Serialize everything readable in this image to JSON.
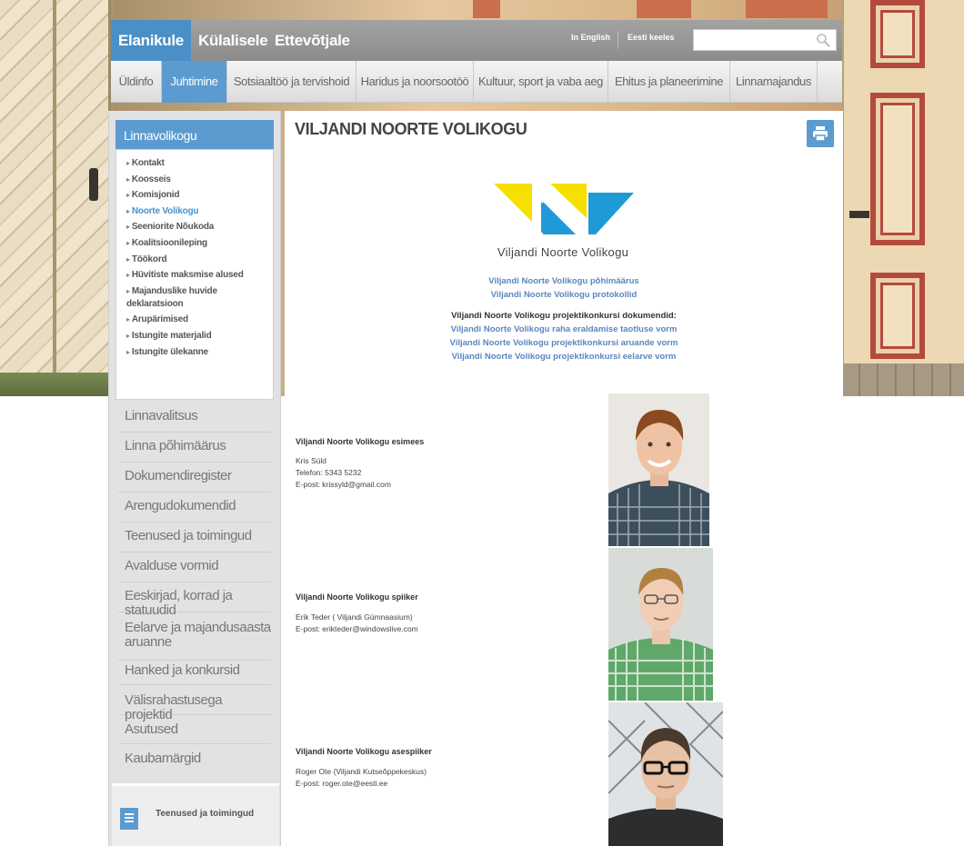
{
  "topnav": {
    "tabs": [
      {
        "label": "Elanikule",
        "active": true
      },
      {
        "label": "Külalisele",
        "active": false
      },
      {
        "label": "Ettevõtjale",
        "active": false
      }
    ],
    "lang_english": "In English",
    "lang_estonian": "Eesti keeles",
    "search_placeholder": ""
  },
  "subnav": {
    "items": [
      {
        "label": "Üldinfo",
        "active": false
      },
      {
        "label": "Juhtimine",
        "active": true
      },
      {
        "label": "Sotsiaaltöö ja tervishoid",
        "active": false
      },
      {
        "label": "Haridus ja noorsootöö",
        "active": false
      },
      {
        "label": "Kultuur, sport ja vaba aeg",
        "active": false
      },
      {
        "label": "Ehitus ja planeerimine",
        "active": false
      },
      {
        "label": "Linnamajandus",
        "active": false
      }
    ]
  },
  "sidebar": {
    "active_section": "Linnavolikogu",
    "sub_items": [
      {
        "label": "Kontakt"
      },
      {
        "label": "Koosseis"
      },
      {
        "label": "Komisjonid"
      },
      {
        "label": "Noorte Volikogu",
        "current": true
      },
      {
        "label": "Seeniorite Nõukoda"
      },
      {
        "label": "Koalitsioonileping"
      },
      {
        "label": "Töökord"
      },
      {
        "label": "Hüvitiste maksmise alused"
      },
      {
        "label": "Majanduslike huvide deklaratsioon"
      },
      {
        "label": "Arupärimised"
      },
      {
        "label": "Istungite materjalid"
      },
      {
        "label": "Istungite ülekanne"
      }
    ],
    "sections": [
      "Linnavalitsus",
      "Linna põhimäärus",
      "Dokumendiregister",
      "Arengudokumendid",
      "Teenused ja toimingud",
      "Avalduse vormid",
      "Eeskirjad, korrad ja statuudid",
      "Eelarve ja majandusaasta aruanne",
      "Hanked ja konkursid",
      "Välisrahastusega projektid",
      "Asutused",
      "Kaubamärgid"
    ],
    "box_label": "Teenused ja toimingud"
  },
  "content": {
    "title": "VILJANDI NOORTE VOLIKOGU",
    "logo_text": "Viljandi Noorte Volikogu",
    "links_top": [
      "Viljandi Noorte Volikogu põhimäärus",
      "Viljandi Noorte Volikogu protokollid"
    ],
    "docs_heading": "Viljandi Noorte Volikogu projektikonkursi dokumendid:",
    "docs_links": [
      "Viljandi Noorte Volikogu raha eraldamise taotluse vorm",
      "Viljandi Noorte Volikogu projektikonkursi aruande vorm",
      "Viljandi Noorte Volikogu projektikonkursi eelarve vorm"
    ],
    "people": [
      {
        "role": "Viljandi Noorte Volikogu esimees",
        "lines": [
          "Kris Süld",
          "Telefon: 5343 5232",
          "E-post: krissyld@gmail.com"
        ]
      },
      {
        "role": "Viljandi Noorte Volikogu spiiker",
        "lines": [
          "Erik Teder ( Viljandi Gümnaasium)",
          "E-post: erikteder@windowslive.com"
        ]
      },
      {
        "role": "Viljandi Noorte Volikogu asespiiker",
        "lines": [
          "Roger Ote (Viljandi Kutseõppekeskus)",
          "E-post: roger.ote@eesti.ee"
        ]
      }
    ]
  },
  "colors": {
    "accent": "#5b9bd0",
    "logo_yellow": "#f5e000",
    "logo_blue": "#1e9ad6",
    "link": "#5a86c0"
  }
}
